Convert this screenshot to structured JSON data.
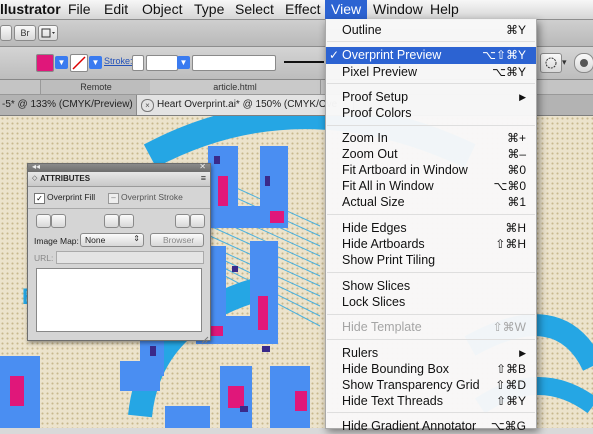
{
  "menubar": {
    "app_name": "llustrator",
    "items": [
      "File",
      "Edit",
      "Object",
      "Type",
      "Select",
      "Effect",
      "View",
      "Window",
      "Help"
    ]
  },
  "toolbar": {
    "br_label": "Br",
    "stroke_label": "Stroke:",
    "remote_label": "Remote",
    "article_label": "article.html"
  },
  "tabs": [
    {
      "label": "-5* @ 133% (CMYK/Preview)"
    },
    {
      "label": "Heart Overprint.ai* @ 150% (CMYK/Ove"
    }
  ],
  "panel": {
    "title": "ATTRIBUTES",
    "overprint_fill": "Overprint Fill",
    "overprint_stroke": "Overprint Stroke",
    "image_map_label": "Image Map:",
    "image_map_value": "None",
    "browser_label": "Browser",
    "url_label": "URL:"
  },
  "view_menu": {
    "items": [
      {
        "label": "Outline",
        "shortcut": "⌘Y"
      },
      {
        "label": "Overprint Preview",
        "shortcut": "⌥⇧⌘Y",
        "checked": true,
        "highlighted": true
      },
      {
        "label": "Pixel Preview",
        "shortcut": "⌥⌘Y"
      },
      {
        "label": "Proof Setup",
        "submenu": true
      },
      {
        "label": "Proof Colors"
      },
      {
        "label": "Zoom In",
        "shortcut": "⌘+"
      },
      {
        "label": "Zoom Out",
        "shortcut": "⌘–"
      },
      {
        "label": "Fit Artboard in Window",
        "shortcut": "⌘0"
      },
      {
        "label": "Fit All in Window",
        "shortcut": "⌥⌘0"
      },
      {
        "label": "Actual Size",
        "shortcut": "⌘1"
      },
      {
        "label": "Hide Edges",
        "shortcut": "⌘H"
      },
      {
        "label": "Hide Artboards",
        "shortcut": "⇧⌘H"
      },
      {
        "label": "Show Print Tiling"
      },
      {
        "label": "Show Slices"
      },
      {
        "label": "Lock Slices"
      },
      {
        "label": "Hide Template",
        "shortcut": "⇧⌘W",
        "disabled": true
      },
      {
        "label": "Rulers",
        "submenu": true
      },
      {
        "label": "Hide Bounding Box",
        "shortcut": "⇧⌘B"
      },
      {
        "label": "Show Transparency Grid",
        "shortcut": "⇧⌘D"
      },
      {
        "label": "Hide Text Threads",
        "shortcut": "⇧⌘Y"
      },
      {
        "label": "Hide Gradient Annotator",
        "shortcut": "⌥⌘G"
      }
    ],
    "checkmark": "✓",
    "submenu_arrow": "▶"
  },
  "colors": {
    "menu_highlight": "#2c63d2",
    "fill_swatch": "#e0177a",
    "art_blue": "#4a8ef2",
    "art_cyan": "#25a6e4",
    "art_magenta": "#e0177a"
  }
}
